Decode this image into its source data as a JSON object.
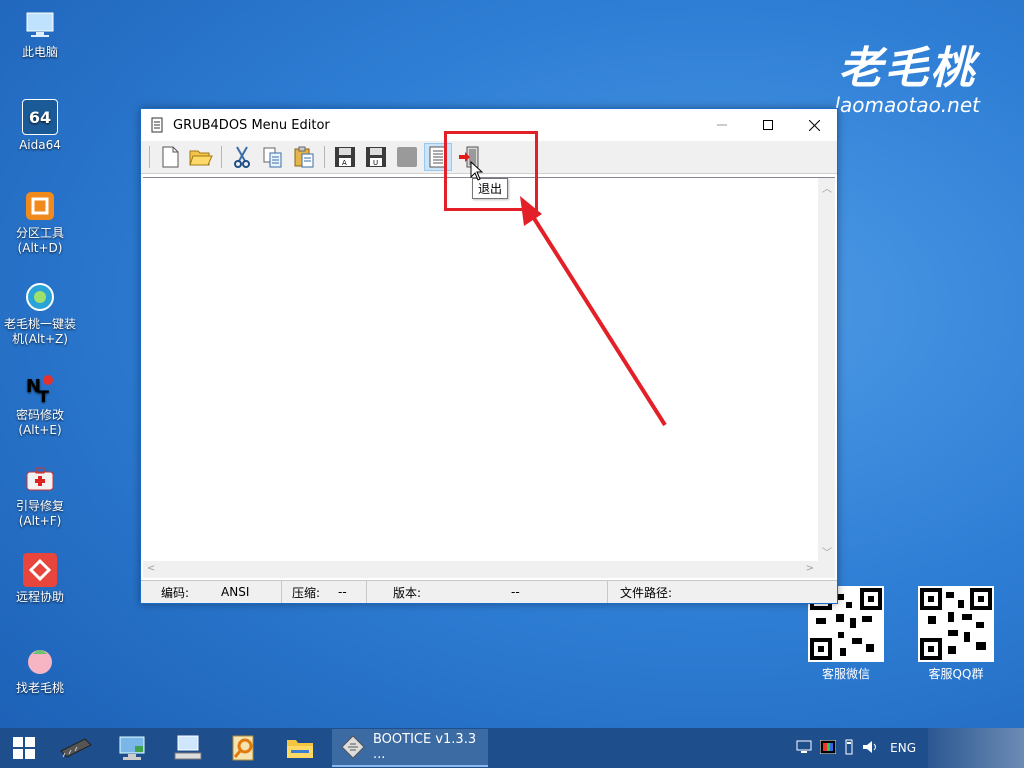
{
  "desktop": {
    "icons": [
      {
        "label": "此电脑"
      },
      {
        "label": "Aida64"
      },
      {
        "label": "分区工具\n(Alt+D)"
      },
      {
        "label": "老毛桃一键装\n机(Alt+Z)"
      },
      {
        "label": "密码修改\n(Alt+E)"
      },
      {
        "label": "引导修复\n(Alt+F)"
      },
      {
        "label": "远程协助"
      },
      {
        "label": "找老毛桃"
      }
    ],
    "aida_icon_text": "64",
    "brand": {
      "title": "老毛桃",
      "url": "laomaotao.net"
    },
    "qr_codes": [
      {
        "label": "客服微信"
      },
      {
        "label": "客服QQ群"
      }
    ]
  },
  "window": {
    "title": "GRUB4DOS Menu Editor",
    "toolbar_icons": [
      "new-file-icon",
      "open-folder-icon",
      "cut-icon",
      "copy-icon",
      "paste-icon",
      "save-ansi-icon",
      "save-unicode-icon",
      "disabled-icon",
      "document-icon",
      "exit-icon"
    ],
    "save_ansi_letter": "A",
    "save_unicode_letter": "U",
    "tooltip": "退出",
    "status": {
      "encoding_label": "编码:",
      "encoding_value": "ANSI",
      "compress_label": "压缩:",
      "compress_value": "--",
      "version_label": "版本:",
      "version_value": "--",
      "path_label": "文件路径:"
    }
  },
  "taskbar": {
    "task_label": "BOOTICE v1.3.3 ...",
    "language": "ENG"
  },
  "colors": {
    "annotation_red": "#e32027",
    "desktop_blue": "#2f7fd6",
    "taskbar": "#1f4e8c"
  }
}
